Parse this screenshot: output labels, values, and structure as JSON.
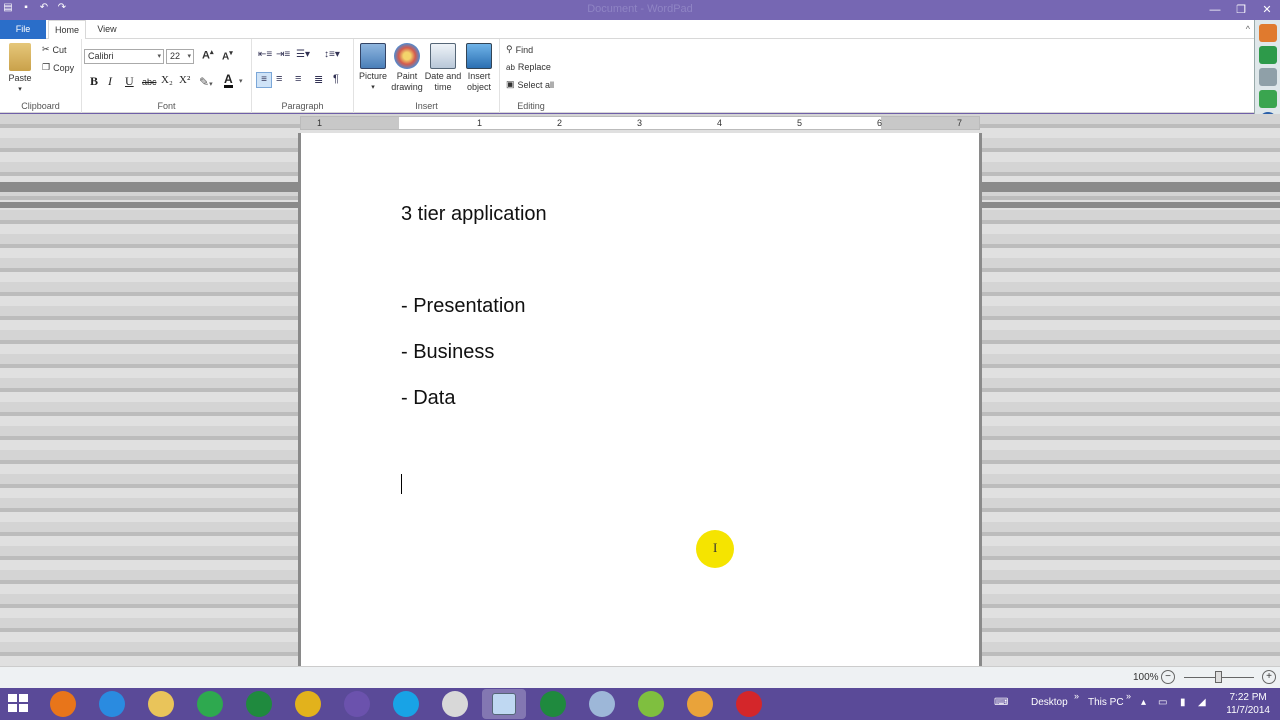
{
  "window": {
    "title": "Document - WordPad"
  },
  "ribbon": {
    "tabs": [
      {
        "label": "File"
      },
      {
        "label": "Home"
      },
      {
        "label": "View"
      }
    ],
    "clipboard": {
      "paste_label": "Paste",
      "cut_label": "Cut",
      "copy_label": "Copy",
      "group_label": "Clipboard"
    },
    "font": {
      "family": "Calibri",
      "size": "22",
      "bold_label": "B",
      "italic_label": "I",
      "underline_label": "U",
      "strike_label": "abc",
      "subscript_label": "X₂",
      "superscript_label": "X²",
      "group_label": "Font"
    },
    "paragraph": {
      "group_label": "Paragraph"
    },
    "insert": {
      "picture_label": "Picture",
      "paint_label_1": "Paint",
      "paint_label_2": "drawing",
      "datetime_label_1": "Date and",
      "datetime_label_2": "time",
      "object_label_1": "Insert",
      "object_label_2": "object",
      "group_label": "Insert"
    },
    "editing": {
      "find_label": "Find",
      "replace_label": "Replace",
      "select_all_label": "Select all",
      "group_label": "Editing"
    }
  },
  "ruler": {
    "ticks": [
      "1",
      "1",
      "2",
      "3",
      "4",
      "5",
      "6",
      "7"
    ]
  },
  "document": {
    "lines": [
      "3 tier application",
      "- Presentation",
      "- Business",
      "- Data"
    ]
  },
  "statusbar": {
    "zoom": "100%",
    "zoom_level_percent": 100
  },
  "taskbar": {
    "apps": [
      {
        "name": "firefox",
        "color": "#e8751a"
      },
      {
        "name": "internet-explorer",
        "color": "#2a8be0"
      },
      {
        "name": "file-explorer",
        "color": "#e9c45a"
      },
      {
        "name": "store",
        "color": "#2ea94f"
      },
      {
        "name": "app-green-s",
        "color": "#1f8a3e"
      },
      {
        "name": "chrome",
        "color": "#e2b21c"
      },
      {
        "name": "visual-studio",
        "color": "#6b52ad"
      },
      {
        "name": "skype",
        "color": "#18a3e6"
      },
      {
        "name": "app-gears",
        "color": "#d8d8d8"
      },
      {
        "name": "wordpad",
        "color": "#bfd8f2"
      },
      {
        "name": "app-green-s-2",
        "color": "#1f8a3e"
      },
      {
        "name": "app-chess",
        "color": "#9db7d8"
      },
      {
        "name": "utorrent",
        "color": "#7fbf3f"
      },
      {
        "name": "app-flower",
        "color": "#e9a33a"
      },
      {
        "name": "acrobat",
        "color": "#d4262a"
      }
    ],
    "desktop_label": "Desktop",
    "thispc_label": "This PC",
    "time": "7:22 PM",
    "date": "11/7/2014"
  }
}
